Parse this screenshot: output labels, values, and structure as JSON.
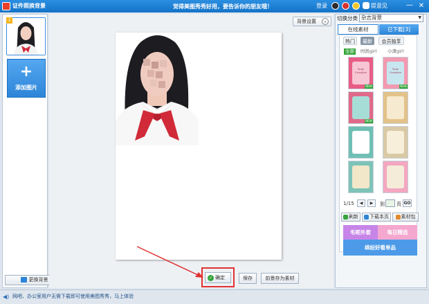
{
  "titlebar": {
    "app_title": "证件照换背景",
    "promo": "觉得美图秀秀好用，要告诉你的朋友哦！",
    "login": "登录",
    "feedback": "提意见",
    "minimize": "—",
    "close": "✕"
  },
  "left": {
    "thumb_badge": "1",
    "add_plus": "+",
    "add_label": "添加图片",
    "change_bg": "更换背景"
  },
  "canvas": {
    "bg_settings": "背景设置",
    "bg_settings_icon": "⌄"
  },
  "bottom": {
    "confirm": "确定",
    "confirm_icon": "✓",
    "save": "保存",
    "save_material": "前景存为素材"
  },
  "status": {
    "icon": "◀)",
    "text": "网吧、办公室用户无需下载即可使用美图秀秀，马上体验"
  },
  "right": {
    "switch_label": "切换分类",
    "category": "杂志背景",
    "category_caret": "▼",
    "tab_online": "在线素材",
    "tab_downloaded": "已下载[3]",
    "sub_tabs": [
      "热门",
      "最新",
      "会员独享"
    ],
    "filters": [
      "全部",
      "时尚girl",
      "小清girl"
    ],
    "tiles": [
      {
        "color": "#e85d86",
        "inner": "#f7c6d4",
        "new": true,
        "title": "Your Creative"
      },
      {
        "color": "#f29ab0",
        "inner": "#c8e6ef",
        "new": true,
        "title": "Your Creative"
      },
      {
        "color": "#e06a8a",
        "inner": "#a7ddd7",
        "new": true,
        "title": ""
      },
      {
        "color": "#e3c28a",
        "inner": "#f6ead0",
        "new": false,
        "title": ""
      },
      {
        "color": "#6fbfb4",
        "inner": "#ffffff",
        "new": false,
        "title": ""
      },
      {
        "color": "#d9c9a5",
        "inner": "#f7efd9",
        "new": false,
        "title": ""
      },
      {
        "color": "#7ec3b8",
        "inner": "#f3e7c9",
        "new": false,
        "title": ""
      },
      {
        "color": "#f3a7c0",
        "inner": "#f4ecd9",
        "new": false,
        "title": ""
      }
    ],
    "new_badge": "NEW",
    "pager": "1/15",
    "prev": "◀",
    "next": "▶",
    "goto_label": "到",
    "page_suffix": "页",
    "go": "GO",
    "refresh": "刷新",
    "download_page": "下载本页",
    "material_pack": "素材包",
    "banner_a": "毛呢外套",
    "banner_b": "每日精选",
    "banner_c": "缤纷好看单品"
  },
  "colors": {
    "accent": "#2d85d8",
    "highlight": "#e03131",
    "success": "#34a53a"
  }
}
